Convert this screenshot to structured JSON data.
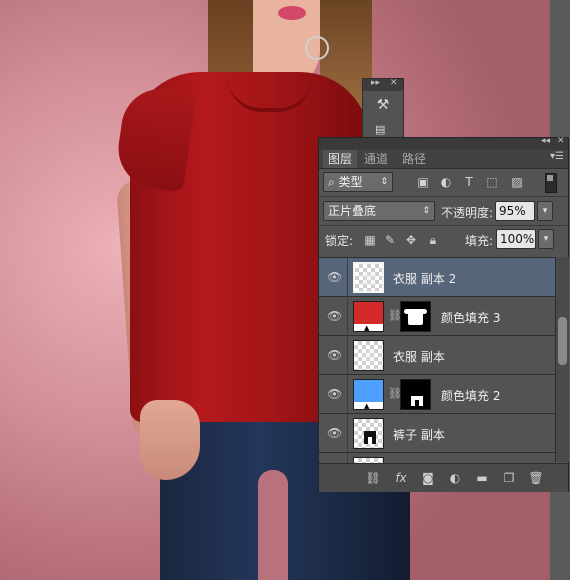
{
  "panel": {
    "tabs": [
      {
        "label": "图层",
        "active": true
      },
      {
        "label": "通道",
        "active": false
      },
      {
        "label": "路径",
        "active": false
      }
    ],
    "filter_kind": "类型",
    "filter_icons": [
      "image-filter-icon",
      "adjustment-filter-icon",
      "type-filter-icon",
      "shape-filter-icon",
      "smart-object-filter-icon"
    ],
    "blend_mode": "正片叠底",
    "opacity_label": "不透明度:",
    "opacity_value": "95%",
    "lock_label": "锁定:",
    "fill_label": "填充:",
    "fill_value": "100%",
    "layers": [
      {
        "name": "衣服 副本 2",
        "selected": true,
        "thumb": "transparent"
      },
      {
        "name": "颜色填充 3",
        "selected": false,
        "thumb": "fill",
        "fill_color": "#d42a2a",
        "mask": "tee"
      },
      {
        "name": "衣服 副本",
        "selected": false,
        "thumb": "transparent"
      },
      {
        "name": "颜色填充 2",
        "selected": false,
        "thumb": "fill",
        "fill_color": "#4da0ff",
        "mask": "pants"
      },
      {
        "name": "裤子 副本",
        "selected": false,
        "thumb": "pants"
      }
    ],
    "bottom_icons": [
      "link-layers-icon",
      "fx-icon",
      "add-mask-icon",
      "new-adjustment-icon",
      "new-group-icon",
      "new-layer-icon",
      "delete-layer-icon"
    ],
    "fx_label": "fx"
  },
  "colors": {
    "panel_bg": "#535353",
    "selected_row": "#566579",
    "canvas_bg": "#d08d95"
  }
}
